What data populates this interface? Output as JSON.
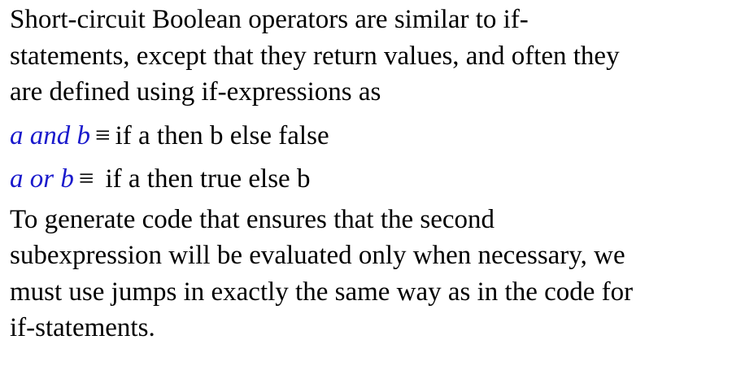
{
  "paragraph1": "Short-circuit Boolean operators are similar to if-statements, except that they return values, and often they are defined using if-expressions as",
  "formula_and": {
    "lhs": "a and b",
    "equiv": "≡",
    "rhs": "if a then b else false"
  },
  "formula_or": {
    "lhs": "a or b",
    "equiv": "≡",
    "rhs": "if a then true else b"
  },
  "paragraph2": "To generate code that ensures that the second subexpression will be evaluated only when necessary, we must use jumps in exactly the same way as in the code for if-statements.",
  "colors": {
    "variable_text": "#1a1acc",
    "body_text": "#000000",
    "background": "#ffffff"
  }
}
